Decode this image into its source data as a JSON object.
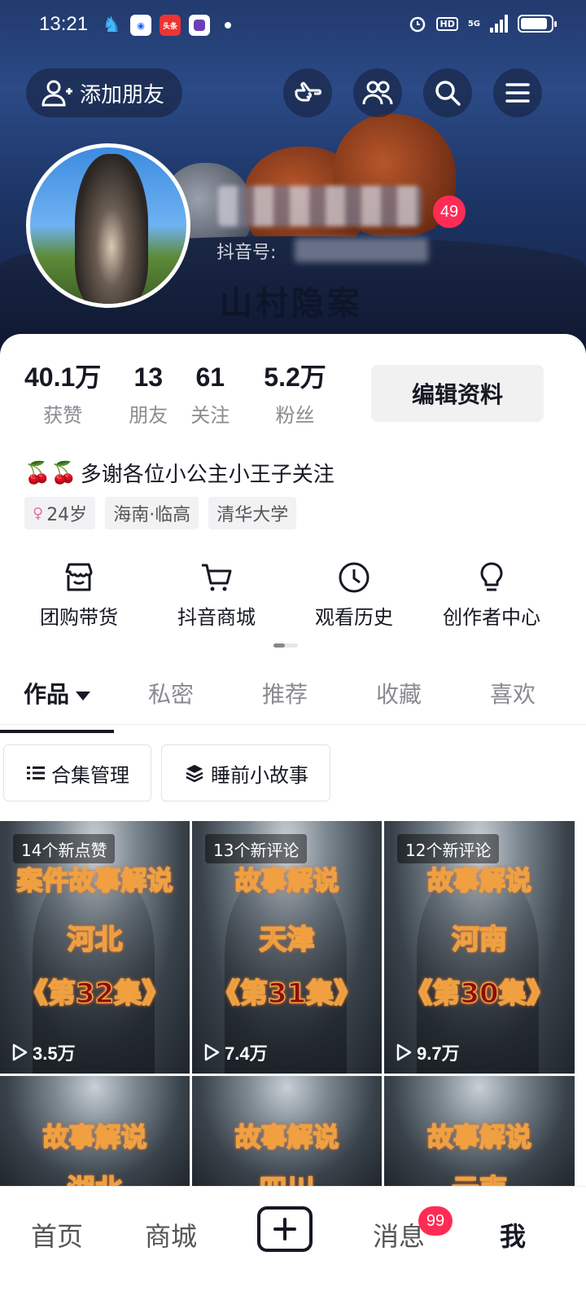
{
  "status_bar": {
    "time": "13:21",
    "toutiao_label": "头条",
    "hd": "HD",
    "network": "5G"
  },
  "header": {
    "add_friend": "添加朋友",
    "icons": [
      "poke-hand-icon",
      "friends-icon",
      "search-icon",
      "menu-icon"
    ],
    "notification_count": "49",
    "douyin_id_label": "抖音号:",
    "cover_watermark": "山村隐案"
  },
  "stats": [
    {
      "value": "40.1万",
      "label": "获赞"
    },
    {
      "value": "13",
      "label": "朋友"
    },
    {
      "value": "61",
      "label": "关注"
    },
    {
      "value": "5.2万",
      "label": "粉丝"
    }
  ],
  "edit_profile": "编辑资料",
  "bio": {
    "emoji": "🍒🍒",
    "text": "多谢各位小公主小王子关注"
  },
  "tags": {
    "age": "24岁",
    "location": "海南·临高",
    "school": "清华大学"
  },
  "quick_actions": [
    {
      "label": "团购带货",
      "icon": "shop-icon"
    },
    {
      "label": "抖音商城",
      "icon": "cart-icon"
    },
    {
      "label": "观看历史",
      "icon": "clock-icon"
    },
    {
      "label": "创作者中心",
      "icon": "bulb-icon"
    }
  ],
  "tabs": [
    "作品",
    "私密",
    "推荐",
    "收藏",
    "喜欢"
  ],
  "chips": [
    "合集管理",
    "睡前小故事"
  ],
  "videos": [
    {
      "notice": "14个新点赞",
      "line1": "案件故事解说",
      "line2": "河北",
      "line3": "《第32集》",
      "views": "3.5万"
    },
    {
      "notice": "13个新评论",
      "line1": "故事解说",
      "line2": "天津",
      "line3": "《第31集》",
      "views": "7.4万"
    },
    {
      "notice": "12个新评论",
      "line1": "故事解说",
      "line2": "河南",
      "line3": "《第30集》",
      "views": "9.7万"
    },
    {
      "line1": "故事解说",
      "line2": "湖北"
    },
    {
      "line1": "故事解说",
      "line2": "四川"
    },
    {
      "line1": "故事解说",
      "line2": "云南"
    }
  ],
  "bottom_nav": {
    "home": "首页",
    "mall": "商城",
    "messages": "消息",
    "messages_badge": "99",
    "me": "我"
  }
}
